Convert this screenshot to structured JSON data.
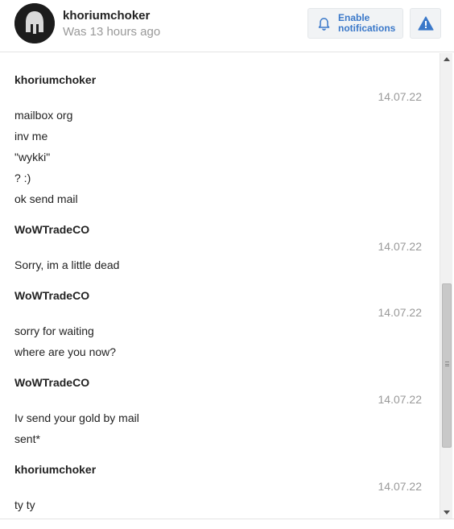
{
  "header": {
    "user_name": "khoriumchoker",
    "status": "Was 13 hours ago",
    "notifications_label_1": "Enable",
    "notifications_label_2": "notifications",
    "icons": {
      "avatar": "spartan-helmet-avatar",
      "bell": "bell-icon",
      "warning": "warning-triangle-icon"
    },
    "accent_color": "#3a78c9"
  },
  "messages": [
    {
      "sender": "khoriumchoker",
      "date": "14.07.22",
      "lines": [
        "mailbox org",
        "inv me",
        "\"wykki\"",
        "? :)",
        "ok send mail"
      ]
    },
    {
      "sender": "WoWTradeCO",
      "date": "14.07.22",
      "lines": [
        "Sorry, im a little dead"
      ]
    },
    {
      "sender": "WoWTradeCO",
      "date": "14.07.22",
      "lines": [
        "sorry for waiting",
        "where are you now?"
      ]
    },
    {
      "sender": "WoWTradeCO",
      "date": "14.07.22",
      "lines": [
        "Iv send your gold by mail",
        "sent*"
      ]
    },
    {
      "sender": "khoriumchoker",
      "date": "14.07.22",
      "lines": [
        "ty ty"
      ]
    }
  ]
}
